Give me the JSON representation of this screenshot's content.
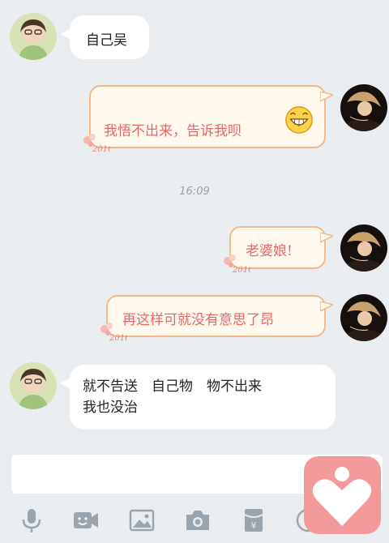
{
  "messages": [
    {
      "side": "left",
      "text": "自己吴"
    },
    {
      "side": "right",
      "text": "我悟不出来，告诉我呗"
    },
    {
      "side": "right",
      "text": "老婆娘!"
    },
    {
      "side": "right",
      "text": "再这样可就没有意思了昂"
    },
    {
      "side": "left",
      "line1": "就不告送　自己物　物不出来",
      "line2": "我也没治"
    }
  ],
  "timestamp": "16:09",
  "bubble_theme": {
    "bg": "#fff9ed",
    "border": "#f3b98a",
    "text": "#e06a6a"
  },
  "toolbar": {
    "icons": [
      "microphone-icon",
      "emoji-video-icon",
      "image-icon",
      "camera-icon",
      "red-packet-icon",
      "more-icon"
    ]
  },
  "overlay": {
    "icon": "heart-person-icon",
    "color": "#f29a9a"
  }
}
